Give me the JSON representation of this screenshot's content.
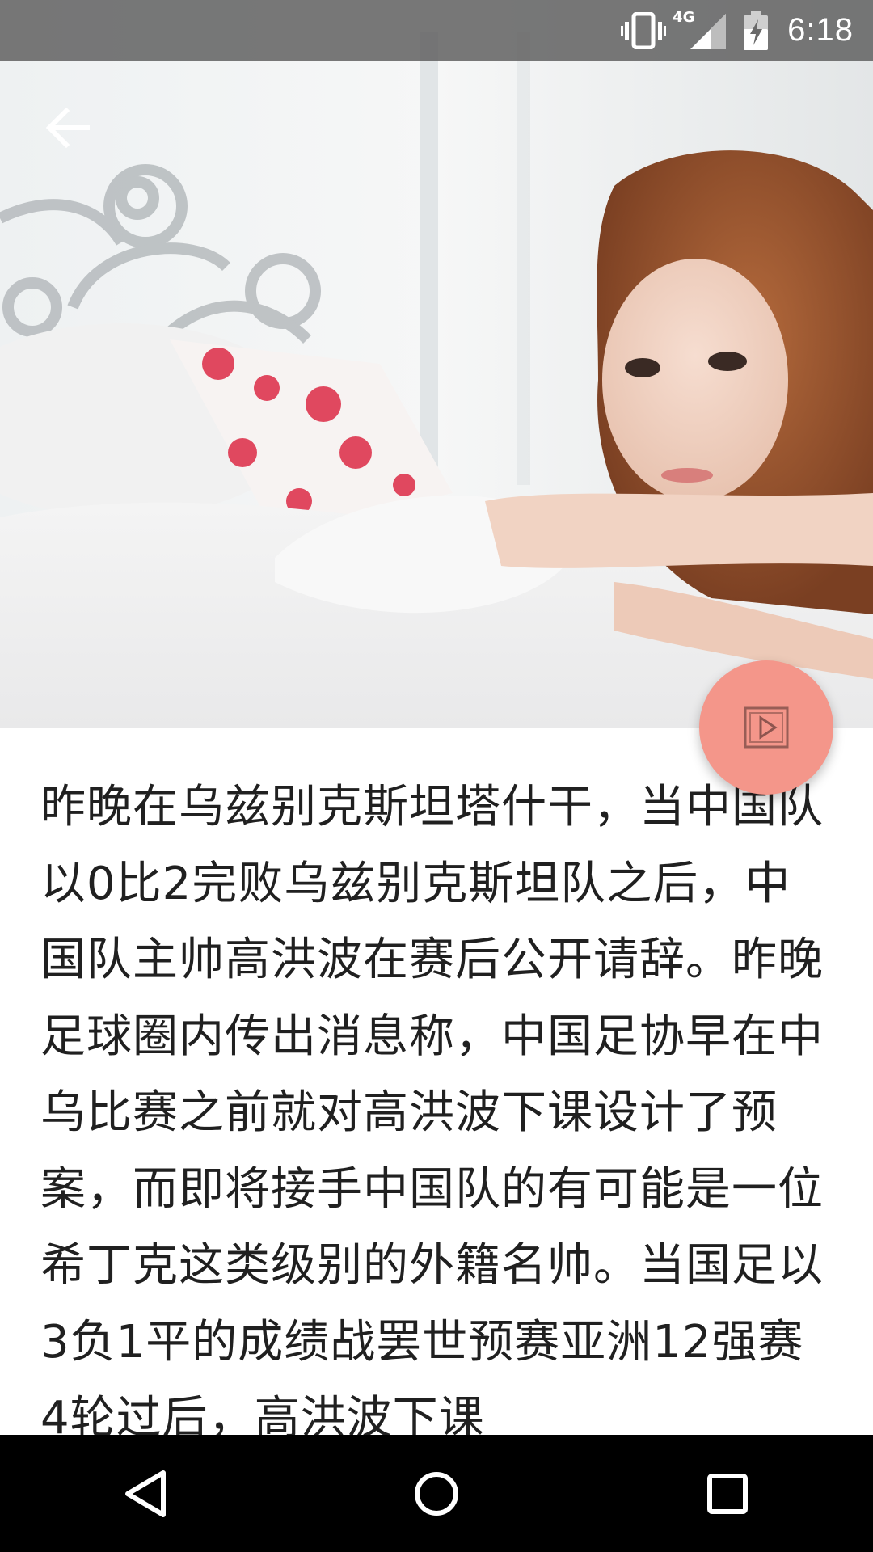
{
  "status_bar": {
    "time": "6:18",
    "network": "4G",
    "icons": [
      "vibrate-icon",
      "cell-signal-icon",
      "battery-charging-icon"
    ]
  },
  "toolbar": {
    "back_icon": "arrow-left-icon"
  },
  "header_image": {
    "description_icon": "photo-woman-on-bed"
  },
  "fab": {
    "icon": "play-video-icon",
    "color": "#f4968a"
  },
  "article": {
    "body": "昨晚在乌兹别克斯坦塔什干，当中国队以0比2完败乌兹别克斯坦队之后，中国队主帅高洪波在赛后公开请辞。昨晚足球圈内传出消息称，中国足协早在中乌比赛之前就对高洪波下课设计了预案，而即将接手中国队的有可能是一位希丁克这类级别的外籍名帅。当国足以3负1平的成绩战罢世预赛亚洲12强赛4轮过后，高洪波下课"
  },
  "nav_bar": {
    "icons": [
      "back-triangle-icon",
      "home-circle-icon",
      "recents-square-icon"
    ]
  }
}
